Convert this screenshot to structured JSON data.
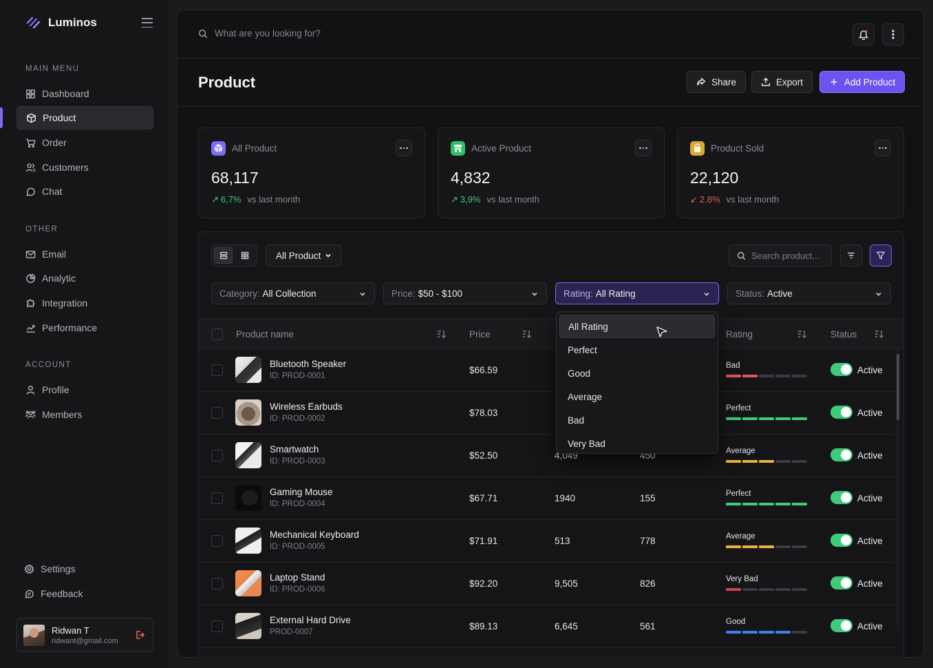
{
  "brand": {
    "name": "Luminos"
  },
  "sidebar": {
    "main_label": "MAIN MENU",
    "main_items": [
      {
        "label": "Dashboard",
        "icon": "grid-icon"
      },
      {
        "label": "Product",
        "icon": "box-icon",
        "active": true
      },
      {
        "label": "Order",
        "icon": "cart-icon"
      },
      {
        "label": "Customers",
        "icon": "users-icon"
      },
      {
        "label": "Chat",
        "icon": "chat-icon"
      }
    ],
    "other_label": "OTHER",
    "other_items": [
      {
        "label": "Email",
        "icon": "mail-icon"
      },
      {
        "label": "Analytic",
        "icon": "pie-chart-icon"
      },
      {
        "label": "Integration",
        "icon": "puzzle-icon"
      },
      {
        "label": "Performance",
        "icon": "chart-icon"
      }
    ],
    "account_label": "ACCOUNT",
    "account_items": [
      {
        "label": "Profile",
        "icon": "user-icon"
      },
      {
        "label": "Members",
        "icon": "members-icon"
      }
    ],
    "bottom_items": [
      {
        "label": "Settings",
        "icon": "gear-icon"
      },
      {
        "label": "Feedback",
        "icon": "feedback-icon"
      }
    ],
    "user": {
      "name": "Ridwan T",
      "email": "ridwant@gmail.com"
    }
  },
  "topbar": {
    "search_placeholder": "What are you looking for?"
  },
  "header": {
    "title": "Product",
    "share_label": "Share",
    "export_label": "Export",
    "add_label": "Add Product"
  },
  "stats": [
    {
      "label": "All Product",
      "value": "68,117",
      "change": "6,7%",
      "direction": "up",
      "vs": "vs last month",
      "icon_color": "#7b6cf6"
    },
    {
      "label": "Active Product",
      "value": "4,832",
      "change": "3,9%",
      "direction": "up",
      "vs": "vs last month",
      "icon_color": "#2fbf6a"
    },
    {
      "label": "Product Sold",
      "value": "22,120",
      "change": "2.8%",
      "direction": "down",
      "vs": "vs last month",
      "icon_color": "#d9a93a"
    }
  ],
  "toolbar": {
    "view_dropdown": "All Product",
    "search_placeholder": "Search product..."
  },
  "filters": [
    {
      "key": "Category:",
      "value": "All Collection"
    },
    {
      "key": "Price:",
      "value": "$50 - $100"
    },
    {
      "key": "Rating:",
      "value": "All Rating",
      "open": true
    },
    {
      "key": "Status:",
      "value": "Active"
    }
  ],
  "columns": {
    "product": "Product name",
    "price": "Price",
    "rating": "Rating",
    "status": "Status"
  },
  "rows": [
    {
      "name": "Bluetooth Speaker",
      "id": "ID: PROD-0001",
      "price": "$66.59",
      "col3": "",
      "col4": "",
      "rating": "Bad",
      "level": 2,
      "bar_color": "#e0555f",
      "status": "Active",
      "thumb": "speaker"
    },
    {
      "name": "Wireless Earbuds",
      "id": "ID: PROD-0002",
      "price": "$78.03",
      "col3": "",
      "col4": "",
      "rating": "Perfect",
      "level": 5,
      "bar_color": "#3ecb7a",
      "status": "Active",
      "thumb": "earbuds"
    },
    {
      "name": "Smartwatch",
      "id": "ID: PROD-0003",
      "price": "$52.50",
      "col3": "4,049",
      "col4": "450",
      "rating": "Average",
      "level": 3,
      "bar_color": "#e8b33c",
      "status": "Active",
      "thumb": "watch"
    },
    {
      "name": "Gaming Mouse",
      "id": "ID: PROD-0004",
      "price": "$67.71",
      "col3": "1940",
      "col4": "155",
      "rating": "Perfect",
      "level": 5,
      "bar_color": "#3ecb7a",
      "status": "Active",
      "thumb": "mouse"
    },
    {
      "name": "Mechanical Keyboard",
      "id": "ID: PROD-0005",
      "price": "$71.91",
      "col3": "513",
      "col4": "778",
      "rating": "Average",
      "level": 3,
      "bar_color": "#e8b33c",
      "status": "Active",
      "thumb": "keyboard"
    },
    {
      "name": "Laptop Stand",
      "id": "ID: PROD-0006",
      "price": "$92.20",
      "col3": "9,505",
      "col4": "826",
      "rating": "Very Bad",
      "level": 1,
      "bar_color": "#c44750",
      "status": "Active",
      "thumb": "stand"
    },
    {
      "name": "External Hard Drive",
      "id": "PROD-0007",
      "price": "$89.13",
      "col3": "6,645",
      "col4": "561",
      "rating": "Good",
      "level": 4,
      "bar_color": "#3f7de8",
      "status": "Active",
      "thumb": "drive"
    }
  ],
  "rating_dropdown": [
    "All Rating",
    "Perfect",
    "Good",
    "Average",
    "Bad",
    "Very Bad"
  ]
}
